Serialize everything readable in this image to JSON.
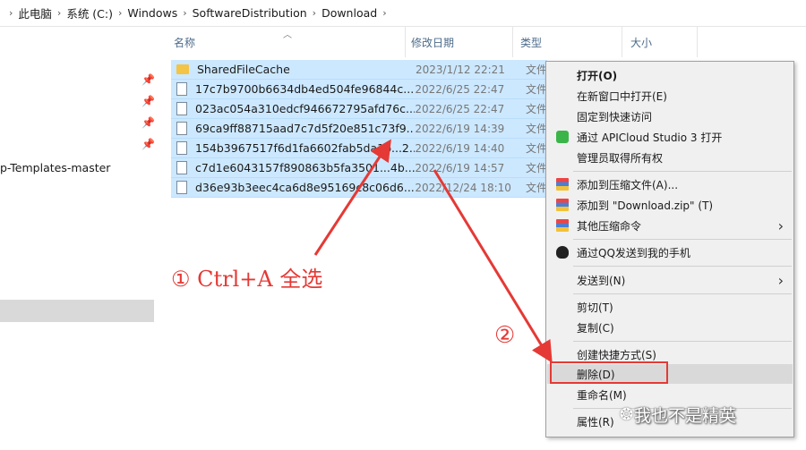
{
  "breadcrumb": [
    "此电脑",
    "系统 (C:)",
    "Windows",
    "SoftwareDistribution",
    "Download"
  ],
  "nav": {
    "truncated_item": "p-Templates-master"
  },
  "columns": {
    "name": "名称",
    "date": "修改日期",
    "type": "类型",
    "size": "大小"
  },
  "files": [
    {
      "name": "SharedFileCache",
      "date": "2023/1/12 22:21",
      "type": "文件",
      "icon": "folder-icon"
    },
    {
      "name": "17c7b9700b6634db4ed504fe96844c...",
      "date": "2022/6/25 22:47",
      "type": "文件",
      "icon": "file-icon"
    },
    {
      "name": "023ac054a310edcf946672795afd76c...",
      "date": "2022/6/25 22:47",
      "type": "文件",
      "icon": "file-icon"
    },
    {
      "name": "69ca9ff88715aad7c7d5f20e851c73f9...",
      "date": "2022/6/19 14:39",
      "type": "文件",
      "icon": "file-icon"
    },
    {
      "name": "154b3967517f6d1fa6602fab5da1b...2...",
      "date": "2022/6/19 14:40",
      "type": "文件",
      "icon": "file-icon"
    },
    {
      "name": "c7d1e6043157f890863b5fa3501...4b...",
      "date": "2022/6/19 14:57",
      "type": "文件",
      "icon": "file-icon"
    },
    {
      "name": "d36e93b3eec4ca6d8e95169c8c06d6...",
      "date": "2022/12/24 18:10",
      "type": "文件",
      "icon": "file-icon"
    }
  ],
  "menu": {
    "open": "打开(O)",
    "open_new_window": "在新窗口中打开(E)",
    "pin_quick_access": "固定到快速访问",
    "apicloud": "通过 APICloud Studio 3 打开",
    "take_ownership": "管理员取得所有权",
    "add_archive": "添加到压缩文件(A)...",
    "add_zip": "添加到 \"Download.zip\" (T)",
    "other_compress": "其他压缩命令",
    "send_qq": "通过QQ发送到我的手机",
    "send_to": "发送到(N)",
    "cut": "剪切(T)",
    "copy": "复制(C)",
    "create_shortcut": "创建快捷方式(S)",
    "delete": "删除(D)",
    "rename": "重命名(M)",
    "properties": "属性(R)"
  },
  "annotations": {
    "step1": "① Ctrl+A 全选",
    "step2": "②"
  },
  "watermark": "我也不是精英",
  "colors": {
    "selection": "#cce8ff",
    "annotation": "#e53935",
    "menu_bg": "#f0f0f0"
  }
}
